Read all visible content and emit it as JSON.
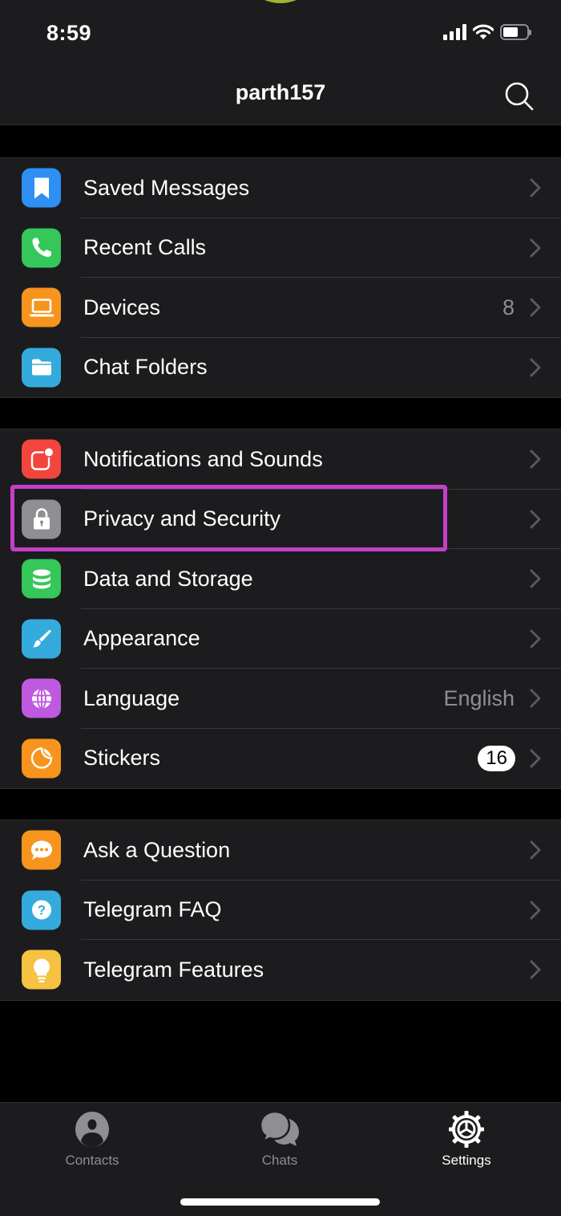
{
  "status_bar": {
    "time": "8:59",
    "battery_level": 0.64
  },
  "header": {
    "title": "parth157",
    "search_icon": "search-icon"
  },
  "groups": [
    {
      "items": [
        {
          "label": "Saved Messages",
          "icon": "bookmark-icon",
          "color": "#2f8ff3",
          "value": null,
          "badge": null
        },
        {
          "label": "Recent Calls",
          "icon": "phone-icon",
          "color": "#35c759",
          "value": null,
          "badge": null
        },
        {
          "label": "Devices",
          "icon": "laptop-icon",
          "color": "#f7941e",
          "value": "8",
          "badge": null
        },
        {
          "label": "Chat Folders",
          "icon": "folder-icon",
          "color": "#35aadc",
          "value": null,
          "badge": null
        }
      ]
    },
    {
      "items": [
        {
          "label": "Notifications and Sounds",
          "icon": "notification-icon",
          "color": "#f2453d",
          "value": null,
          "badge": null
        },
        {
          "label": "Privacy and Security",
          "icon": "lock-icon",
          "color": "#8e8e93",
          "value": null,
          "badge": null,
          "highlighted": true
        },
        {
          "label": "Data and Storage",
          "icon": "database-icon",
          "color": "#35c759",
          "value": null,
          "badge": null
        },
        {
          "label": "Appearance",
          "icon": "brush-icon",
          "color": "#35aadc",
          "value": null,
          "badge": null
        },
        {
          "label": "Language",
          "icon": "globe-icon",
          "color": "#bf5ae0",
          "value": "English",
          "badge": null
        },
        {
          "label": "Stickers",
          "icon": "sticker-icon",
          "color": "#f7941e",
          "value": null,
          "badge": "16"
        }
      ]
    },
    {
      "items": [
        {
          "label": "Ask a Question",
          "icon": "chat-bubble-icon",
          "color": "#f7941e",
          "value": null,
          "badge": null
        },
        {
          "label": "Telegram FAQ",
          "icon": "question-icon",
          "color": "#35aadc",
          "value": null,
          "badge": null
        },
        {
          "label": "Telegram Features",
          "icon": "lightbulb-icon",
          "color": "#f5c242",
          "value": null,
          "badge": null
        }
      ]
    }
  ],
  "highlight_color": "#c43fc9",
  "tabbar": {
    "tabs": [
      {
        "label": "Contacts",
        "icon": "contacts-icon",
        "active": false
      },
      {
        "label": "Chats",
        "icon": "chats-icon",
        "active": false
      },
      {
        "label": "Settings",
        "icon": "settings-icon",
        "active": true
      }
    ]
  }
}
